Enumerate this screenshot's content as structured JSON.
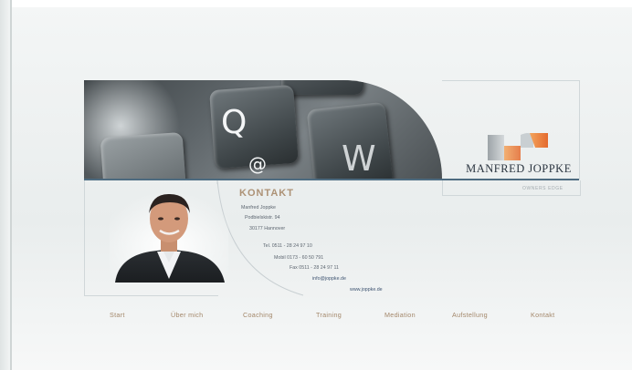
{
  "brand": {
    "name": "MANFRED JOPPKE",
    "tagline": "OWNERS EDGE",
    "colors": {
      "accent": "#ad9276",
      "line": "#4d6b80",
      "logo_orange": "#e9783a"
    }
  },
  "header": {
    "keys": {
      "q": "Q",
      "at": "@",
      "w": "W"
    }
  },
  "contact": {
    "heading": "KONTAKT",
    "lines": [
      "Manfred Joppke",
      "Podbielskistr. 94",
      "30177 Hannover",
      "Tel. 0511 - 28 24 97 10",
      "Mobil 0173 - 60 50 791",
      "Fax 0511 - 28 24 97 11",
      "info@joppke.de",
      "www.joppke.de"
    ]
  },
  "nav": {
    "items": [
      "Start",
      "Über mich",
      "Coaching",
      "Training",
      "Mediation",
      "Aufstellung",
      "Kontakt"
    ]
  },
  "icons": {
    "logo": "joppke-logo-icon",
    "portrait": "portrait-photo"
  }
}
